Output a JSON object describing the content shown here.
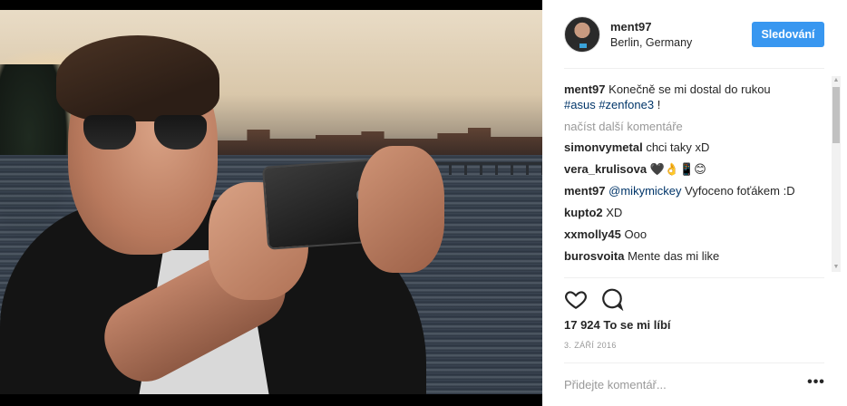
{
  "post": {
    "author": "ment97",
    "location": "Berlin, Germany",
    "follow_label": "Sledování"
  },
  "caption": {
    "user": "ment97",
    "text": "Konečně se mi dostal do rukou",
    "hashtags": [
      "#asus",
      "#zenfone3"
    ],
    "suffix": "!"
  },
  "load_more": "načíst další komentáře",
  "comments": [
    {
      "user": "simonvymetal",
      "text": "chci taky xD"
    },
    {
      "user": "vera_krulisova",
      "text": "🖤👌📱😊"
    },
    {
      "user": "ment97",
      "mention": "@mikymickey",
      "text": "Vyfoceno foťákem :D"
    },
    {
      "user": "kupto2",
      "text": "XD"
    },
    {
      "user": "xxmolly45",
      "text": "Ooo"
    },
    {
      "user": "burosvoita",
      "text": "Mente das mi like"
    }
  ],
  "stats": {
    "likes": "17 924 To se mi líbí",
    "date": "3. ZÁŘÍ 2016"
  },
  "add_comment": {
    "placeholder": "Přidejte komentář...",
    "more_label": "•••"
  },
  "icons": {
    "like": "heart-icon",
    "comment": "comment-icon",
    "options": "ellipsis-icon"
  },
  "colors": {
    "accent": "#3897f0",
    "hashtag": "#003569",
    "muted": "#999999",
    "text": "#262626"
  }
}
